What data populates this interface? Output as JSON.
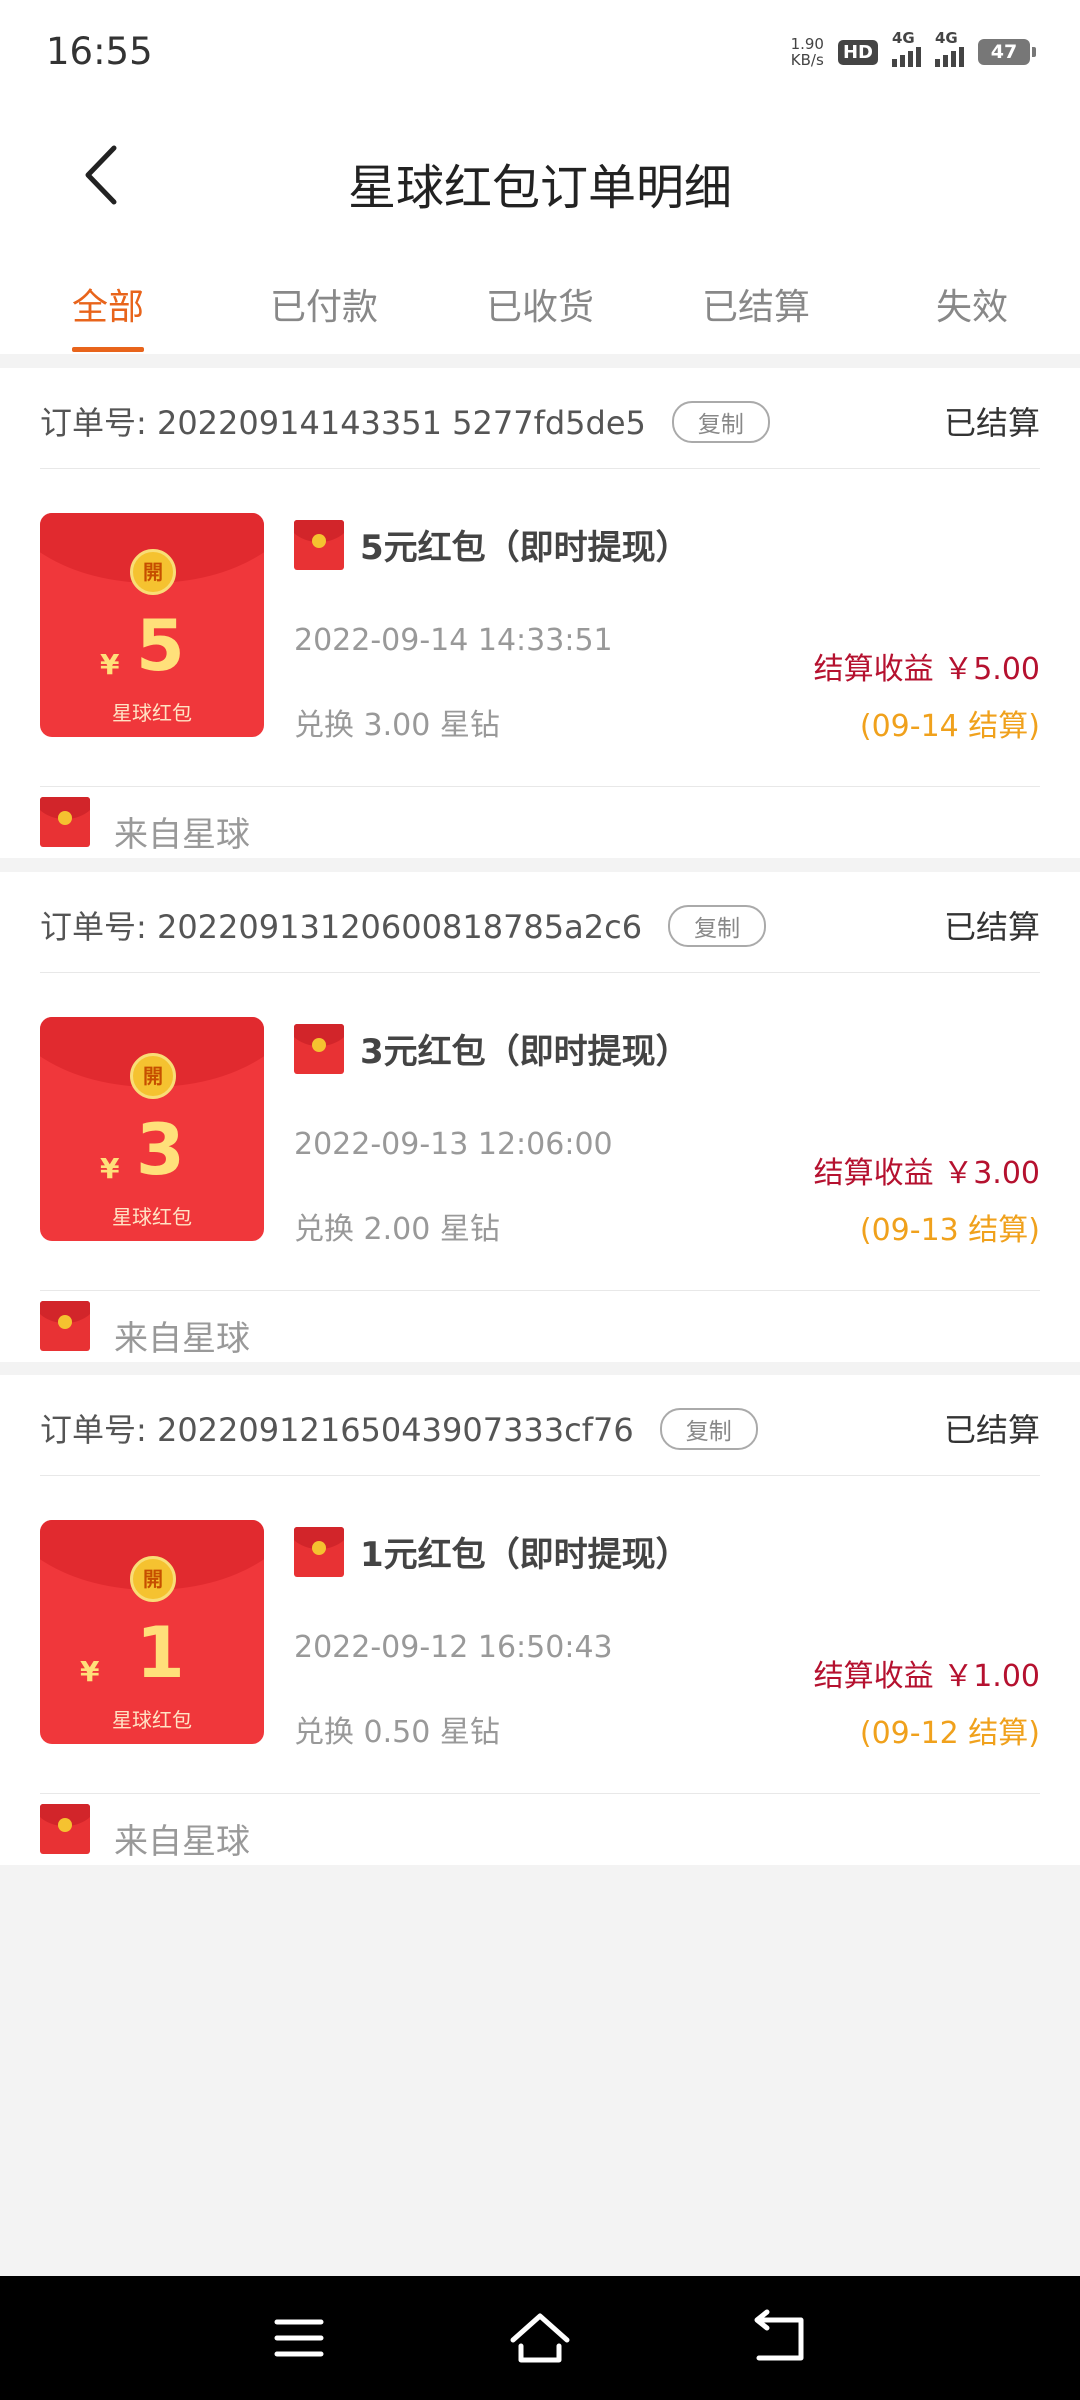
{
  "status_bar": {
    "time": "16:55",
    "net_speed_value": "1.90",
    "net_speed_unit": "KB/s",
    "hd_label": "HD",
    "network_1": "4G",
    "network_2": "4G",
    "battery": "47"
  },
  "header": {
    "title": "星球红包订单明细",
    "back_icon": "chevron-left-icon"
  },
  "tabs": [
    {
      "label": "全部",
      "active": true
    },
    {
      "label": "已付款",
      "active": false
    },
    {
      "label": "已收货",
      "active": false
    },
    {
      "label": "已结算",
      "active": false
    },
    {
      "label": "失效",
      "active": false
    }
  ],
  "orders": [
    {
      "order_no": "订单号: 20220914143351 5277fd5de5",
      "copy_label": "复制",
      "status": "已结算",
      "envelope_amount": "5",
      "envelope_yen": "¥",
      "envelope_coin": "開",
      "envelope_label": "星球红包",
      "product": "5元红包（即时提现）",
      "time": "2022-09-14 14:33:51",
      "exchange": "兑换 3.00 星钻",
      "income": "结算收益 ￥5.00",
      "settle_date": "(09-14 结算)",
      "from": "来自星球"
    },
    {
      "order_no": "订单号: 20220913120600818785a2c6",
      "copy_label": "复制",
      "status": "已结算",
      "envelope_amount": "3",
      "envelope_yen": "¥",
      "envelope_coin": "開",
      "envelope_label": "星球红包",
      "product": "3元红包（即时提现）",
      "time": "2022-09-13 12:06:00",
      "exchange": "兑换 2.00 星钻",
      "income": "结算收益 ￥3.00",
      "settle_date": "(09-13 结算)",
      "from": "来自星球"
    },
    {
      "order_no": "订单号: 20220912165043907333cf76",
      "copy_label": "复制",
      "status": "已结算",
      "envelope_amount": "1",
      "envelope_yen": "¥",
      "envelope_coin": "開",
      "envelope_label": "星球红包",
      "product": "1元红包（即时提现）",
      "time": "2022-09-12 16:50:43",
      "exchange": "兑换 0.50 星钻",
      "income": "结算收益 ￥1.00",
      "settle_date": "(09-12 结算)",
      "from": "来自星球"
    }
  ],
  "navbar": {
    "menu_icon": "menu-icon",
    "home_icon": "home-icon",
    "back_icon": "back-icon"
  },
  "colors": {
    "accent": "#e8641b",
    "income": "#b5112f",
    "settle": "#f0a11c",
    "envelope": "#f0373b"
  }
}
